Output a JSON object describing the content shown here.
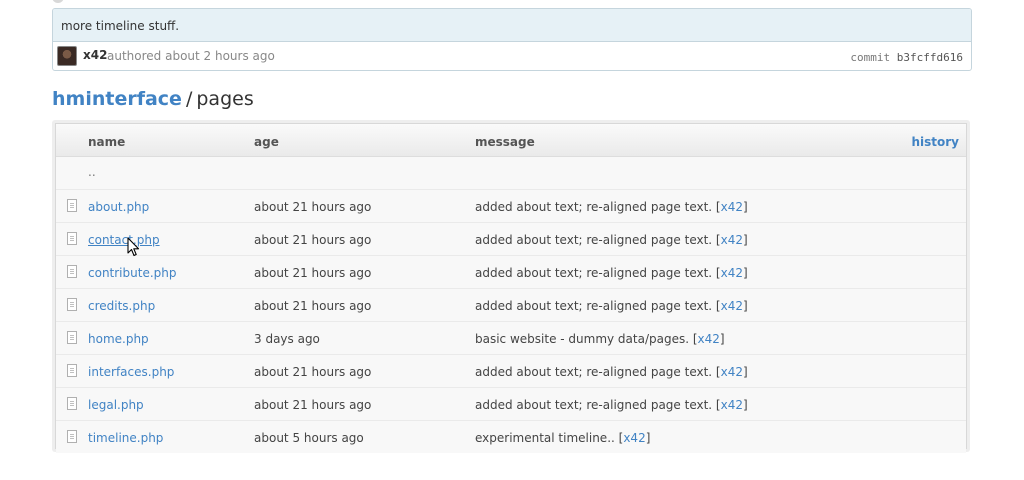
{
  "commit": {
    "message": "more timeline stuff.",
    "author": "x42",
    "authored_text": "authored about 2 hours ago",
    "sha_label": "commit",
    "sha": "b3fcffd616"
  },
  "breadcrumb": {
    "repo": "hminterface",
    "separator": "/",
    "path": "pages"
  },
  "tree": {
    "headers": {
      "name": "name",
      "age": "age",
      "message": "message",
      "history": "history"
    },
    "updir": "..",
    "rows": [
      {
        "name": "about.php",
        "age": "about 21 hours ago",
        "message": "added about text; re-aligned page text.",
        "author": "x42"
      },
      {
        "name": "contact.php",
        "age": "about 21 hours ago",
        "message": "added about text; re-aligned page text.",
        "author": "x42"
      },
      {
        "name": "contribute.php",
        "age": "about 21 hours ago",
        "message": "added about text; re-aligned page text.",
        "author": "x42"
      },
      {
        "name": "credits.php",
        "age": "about 21 hours ago",
        "message": "added about text; re-aligned page text.",
        "author": "x42"
      },
      {
        "name": "home.php",
        "age": "3 days ago",
        "message": "basic website - dummy data/pages.",
        "author": "x42"
      },
      {
        "name": "interfaces.php",
        "age": "about 21 hours ago",
        "message": "added about text; re-aligned page text.",
        "author": "x42"
      },
      {
        "name": "legal.php",
        "age": "about 21 hours ago",
        "message": "added about text; re-aligned page text.",
        "author": "x42"
      },
      {
        "name": "timeline.php",
        "age": "about 5 hours ago",
        "message": "experimental timeline..",
        "author": "x42"
      }
    ]
  },
  "colors": {
    "link": "#4183c4",
    "commit_header_bg": "#e6f1f6"
  }
}
